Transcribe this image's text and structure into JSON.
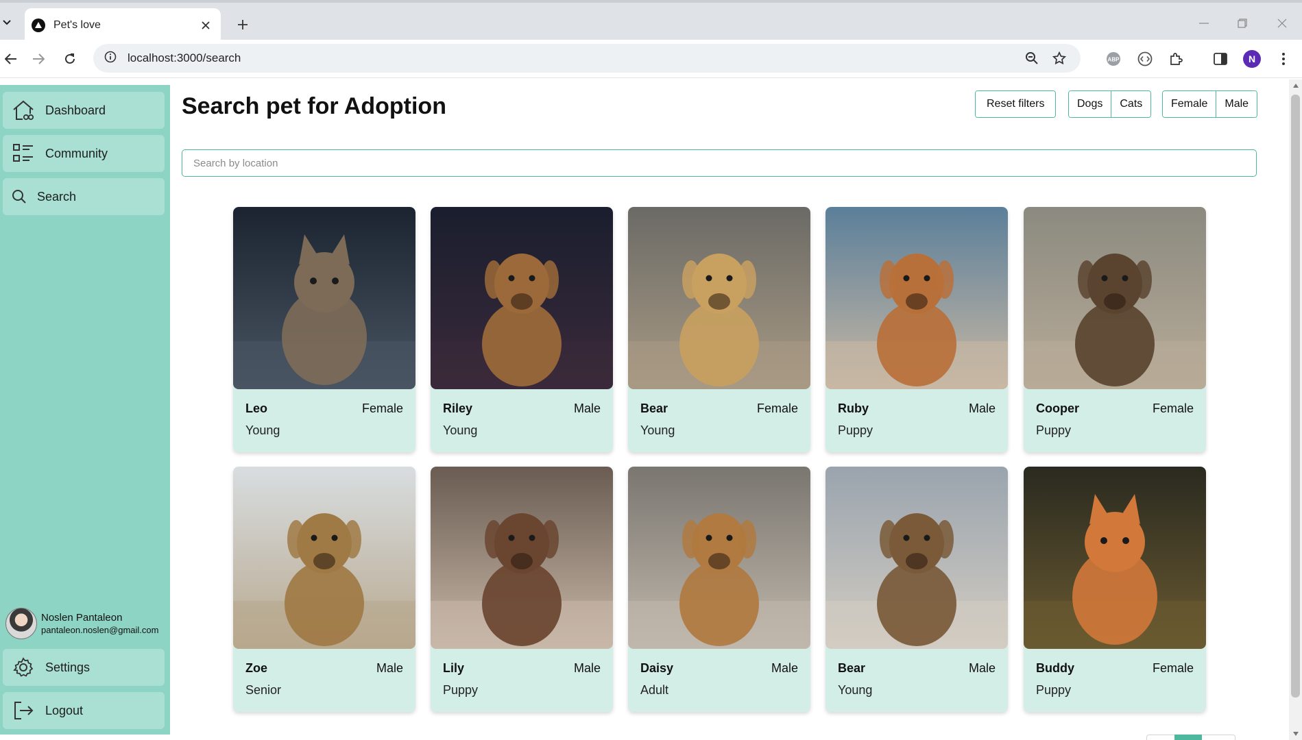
{
  "browser": {
    "tab_title": "Pet's love",
    "url": "localhost:3000/search",
    "profile_initial": "N"
  },
  "sidebar": {
    "items": [
      {
        "label": "Dashboard",
        "icon": "home-icon"
      },
      {
        "label": "Community",
        "icon": "list-icon"
      },
      {
        "label": "Search",
        "icon": "search-icon"
      }
    ],
    "user": {
      "name": "Noslen Pantaleon",
      "email": "pantaleon.noslen@gmail.com"
    },
    "bottom_items": [
      {
        "label": "Settings",
        "icon": "gear-icon"
      },
      {
        "label": "Logout",
        "icon": "logout-icon"
      }
    ]
  },
  "main": {
    "title": "Search pet for Adoption",
    "filters": {
      "reset": "Reset filters",
      "species": [
        "Dogs",
        "Cats"
      ],
      "gender": [
        "Female",
        "Male"
      ]
    },
    "search": {
      "placeholder": "Search by location",
      "value": ""
    },
    "pets": [
      {
        "name": "Leo",
        "gender": "Female",
        "age": "Young",
        "kind": "cat"
      },
      {
        "name": "Riley",
        "gender": "Male",
        "age": "Young",
        "kind": "dog"
      },
      {
        "name": "Bear",
        "gender": "Female",
        "age": "Young",
        "kind": "dog"
      },
      {
        "name": "Ruby",
        "gender": "Male",
        "age": "Puppy",
        "kind": "dog"
      },
      {
        "name": "Cooper",
        "gender": "Female",
        "age": "Puppy",
        "kind": "dog"
      },
      {
        "name": "Zoe",
        "gender": "Male",
        "age": "Senior",
        "kind": "dog"
      },
      {
        "name": "Lily",
        "gender": "Male",
        "age": "Puppy",
        "kind": "dog"
      },
      {
        "name": "Daisy",
        "gender": "Male",
        "age": "Adult",
        "kind": "dog"
      },
      {
        "name": "Bear",
        "gender": "Male",
        "age": "Young",
        "kind": "dog"
      },
      {
        "name": "Buddy",
        "gender": "Female",
        "age": "Puppy",
        "kind": "cat"
      }
    ]
  },
  "colors": {
    "sidebar_bg": "#8dd4c4",
    "nav_item_bg": "#a9e0d3",
    "card_bg": "#d3eee7",
    "accent": "#4db89e"
  }
}
